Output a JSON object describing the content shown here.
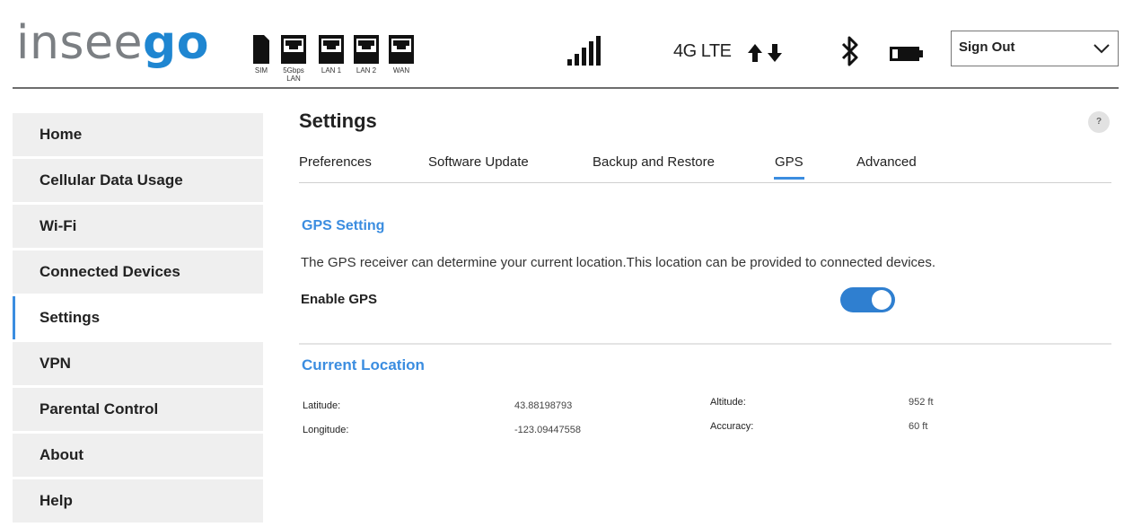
{
  "header": {
    "logo": {
      "part1": "insee",
      "part2": "go"
    },
    "ports": [
      {
        "label": "SIM",
        "icon": "sim-card-icon"
      },
      {
        "label": "5Gbps\nLAN",
        "icon": "ethernet-port-icon"
      },
      {
        "label": "LAN 1",
        "icon": "ethernet-port-icon"
      },
      {
        "label": "LAN 2",
        "icon": "ethernet-port-icon"
      },
      {
        "label": "WAN",
        "icon": "ethernet-port-icon"
      }
    ],
    "network_type": "4G LTE",
    "signout_label": "Sign Out",
    "icons": [
      "signal-bars-icon",
      "up-down-arrows-icon",
      "bluetooth-icon",
      "battery-icon",
      "chevron-down-icon"
    ]
  },
  "sidebar": {
    "items": [
      {
        "label": "Home",
        "active": false
      },
      {
        "label": "Cellular Data Usage",
        "active": false
      },
      {
        "label": "Wi-Fi",
        "active": false
      },
      {
        "label": "Connected Devices",
        "active": false
      },
      {
        "label": "Settings",
        "active": true
      },
      {
        "label": "VPN",
        "active": false
      },
      {
        "label": "Parental Control",
        "active": false
      },
      {
        "label": "About",
        "active": false
      },
      {
        "label": "Help",
        "active": false
      }
    ]
  },
  "main": {
    "title": "Settings",
    "help_label": "?",
    "tabs": [
      {
        "label": "Preferences",
        "active": false
      },
      {
        "label": "Software Update",
        "active": false
      },
      {
        "label": "Backup and Restore",
        "active": false
      },
      {
        "label": "GPS",
        "active": true
      },
      {
        "label": "Advanced",
        "active": false
      }
    ],
    "gps_setting": {
      "title": "GPS Setting",
      "description": "The GPS receiver can determine your current location.This location can be provided to connected devices.",
      "enable_label": "Enable GPS",
      "enabled": true
    },
    "current_location": {
      "title": "Current Location",
      "latitude_label": "Latitude:",
      "latitude": "43.88198793",
      "longitude_label": "Longitude:",
      "longitude": "-123.09447558",
      "altitude_label": "Altitude:",
      "altitude": "952 ft",
      "accuracy_label": "Accuracy:",
      "accuracy": "60 ft"
    }
  },
  "colors": {
    "accent": "#3b8de0",
    "toggle_on": "#2f7fd0",
    "logo_gray": "#7b7f83",
    "logo_blue": "#1f86d1",
    "sidebar_bg": "#efefef"
  }
}
